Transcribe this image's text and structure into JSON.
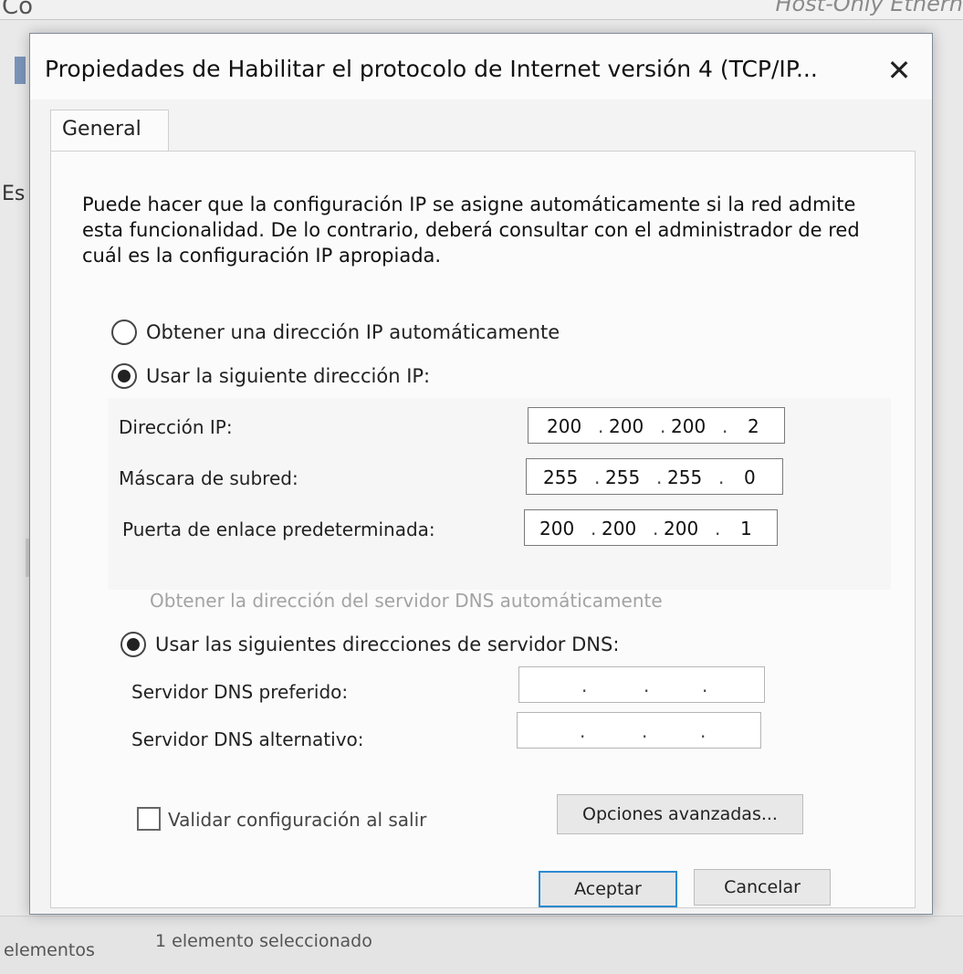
{
  "background": {
    "title_left": "Co",
    "title_right": "Host-Only Ethern",
    "sidebar_label": "Es",
    "status_items_count": "elementos",
    "status_selected": "1 elemento seleccionado"
  },
  "dialog": {
    "title": "Propiedades de Habilitar el protocolo de Internet versión 4 (TCP/IP...",
    "close_icon": "close-icon",
    "tab_label": "General",
    "description": "Puede hacer que la configuración IP se asigne automáticamente si la red admite esta funcionalidad. De lo contrario, deberá consultar con el administrador de red cuál es la configuración IP apropiada.",
    "ip_mode": {
      "auto_label": "Obtener una dirección IP automáticamente",
      "manual_label": "Usar la siguiente dirección IP:",
      "selected": "manual"
    },
    "ip_fields": {
      "ip_address": {
        "label": "Dirección IP:",
        "octets": [
          "200",
          "200",
          "200",
          "2"
        ]
      },
      "subnet_mask": {
        "label": "Máscara de subred:",
        "octets": [
          "255",
          "255",
          "255",
          "0"
        ]
      },
      "gateway": {
        "label": "Puerta de enlace predeterminada:",
        "octets": [
          "200",
          "200",
          "200",
          "1"
        ]
      }
    },
    "dns_mode": {
      "auto_label": "Obtener la dirección del servidor DNS automáticamente",
      "manual_label": "Usar las siguientes direcciones de servidor DNS:",
      "selected": "manual"
    },
    "dns_fields": {
      "preferred": {
        "label": "Servidor DNS preferido:",
        "octets": [
          "",
          "",
          "",
          ""
        ]
      },
      "alternate": {
        "label": "Servidor DNS alternativo:",
        "octets": [
          "",
          "",
          "",
          ""
        ]
      }
    },
    "validate_checkbox": {
      "label": "Validar configuración al salir",
      "checked": false
    },
    "buttons": {
      "advanced": "Opciones avanzadas...",
      "ok": "Aceptar",
      "cancel": "Cancelar"
    }
  },
  "colors": {
    "accent_border": "#2c8ad1",
    "disabled_text": "#a3a3a3"
  }
}
